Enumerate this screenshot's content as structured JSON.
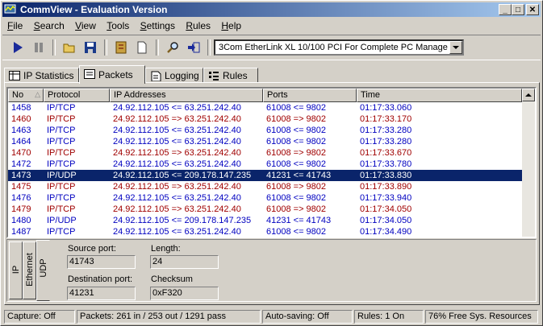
{
  "window": {
    "title": "CommView - Evaluation Version"
  },
  "menu": [
    "File",
    "Search",
    "View",
    "Tools",
    "Settings",
    "Rules",
    "Help"
  ],
  "toolbar": {
    "buttons": [
      "play-icon",
      "pause-icon",
      "open-folder-icon",
      "save-icon",
      "reconstruct-icon",
      "new-document-icon",
      "find-icon",
      "export-icon"
    ],
    "adapter": "3Com EtherLink XL 10/100 PCI For Complete PC Management"
  },
  "tabs": [
    "IP Statistics",
    "Packets",
    "Logging",
    "Rules"
  ],
  "active_tab": "Packets",
  "packet_list": {
    "columns": [
      "No",
      "Protocol",
      "IP Addresses",
      "Ports",
      "Time"
    ],
    "rows": [
      {
        "no": "1458",
        "protocol": "IP/TCP",
        "ip": "24.92.112.105 <= 63.251.242.40",
        "ports": "61008 <= 9802",
        "time": "01:17:33.060",
        "dir": "in"
      },
      {
        "no": "1460",
        "protocol": "IP/TCP",
        "ip": "24.92.112.105 => 63.251.242.40",
        "ports": "61008 => 9802",
        "time": "01:17:33.170",
        "dir": "out"
      },
      {
        "no": "1463",
        "protocol": "IP/TCP",
        "ip": "24.92.112.105 <= 63.251.242.40",
        "ports": "61008 <= 9802",
        "time": "01:17:33.280",
        "dir": "in"
      },
      {
        "no": "1464",
        "protocol": "IP/TCP",
        "ip": "24.92.112.105 <= 63.251.242.40",
        "ports": "61008 <= 9802",
        "time": "01:17:33.280",
        "dir": "in"
      },
      {
        "no": "1470",
        "protocol": "IP/TCP",
        "ip": "24.92.112.105 => 63.251.242.40",
        "ports": "61008 => 9802",
        "time": "01:17:33.670",
        "dir": "out"
      },
      {
        "no": "1472",
        "protocol": "IP/TCP",
        "ip": "24.92.112.105 <= 63.251.242.40",
        "ports": "61008 <= 9802",
        "time": "01:17:33.780",
        "dir": "in"
      },
      {
        "no": "1473",
        "protocol": "IP/UDP",
        "ip": "24.92.112.105 <= 209.178.147.235",
        "ports": "41231 <= 41743",
        "time": "01:17:33.830",
        "dir": "in",
        "selected": true
      },
      {
        "no": "1475",
        "protocol": "IP/TCP",
        "ip": "24.92.112.105 => 63.251.242.40",
        "ports": "61008 => 9802",
        "time": "01:17:33.890",
        "dir": "out"
      },
      {
        "no": "1476",
        "protocol": "IP/TCP",
        "ip": "24.92.112.105 <= 63.251.242.40",
        "ports": "61008 <= 9802",
        "time": "01:17:33.940",
        "dir": "in"
      },
      {
        "no": "1479",
        "protocol": "IP/TCP",
        "ip": "24.92.112.105 => 63.251.242.40",
        "ports": "61008 => 9802",
        "time": "01:17:34.050",
        "dir": "out"
      },
      {
        "no": "1480",
        "protocol": "IP/UDP",
        "ip": "24.92.112.105 <= 209.178.147.235",
        "ports": "41231 <= 41743",
        "time": "01:17:34.050",
        "dir": "in"
      },
      {
        "no": "1487",
        "protocol": "IP/TCP",
        "ip": "24.92.112.105 <= 63.251.242.40",
        "ports": "61008 <= 9802",
        "time": "01:17:34.490",
        "dir": "in"
      }
    ]
  },
  "detail": {
    "vtabs": [
      "IP",
      "Ethernet",
      "UDP"
    ],
    "source_port_label": "Source port:",
    "source_port": "41743",
    "length_label": "Length:",
    "length": "24",
    "dest_port_label": "Destination port:",
    "dest_port": "41231",
    "checksum_label": "Checksum",
    "checksum": "0xF320"
  },
  "status": {
    "capture": "Capture: Off",
    "packets": "Packets: 261 in / 253 out / 1291 pass",
    "autosave": "Auto-saving: Off",
    "rules": "Rules: 1 On",
    "resources": "76% Free Sys. Resources"
  },
  "colors": {
    "in": "#0000c0",
    "out": "#a00000",
    "selection": "#0a246a"
  }
}
